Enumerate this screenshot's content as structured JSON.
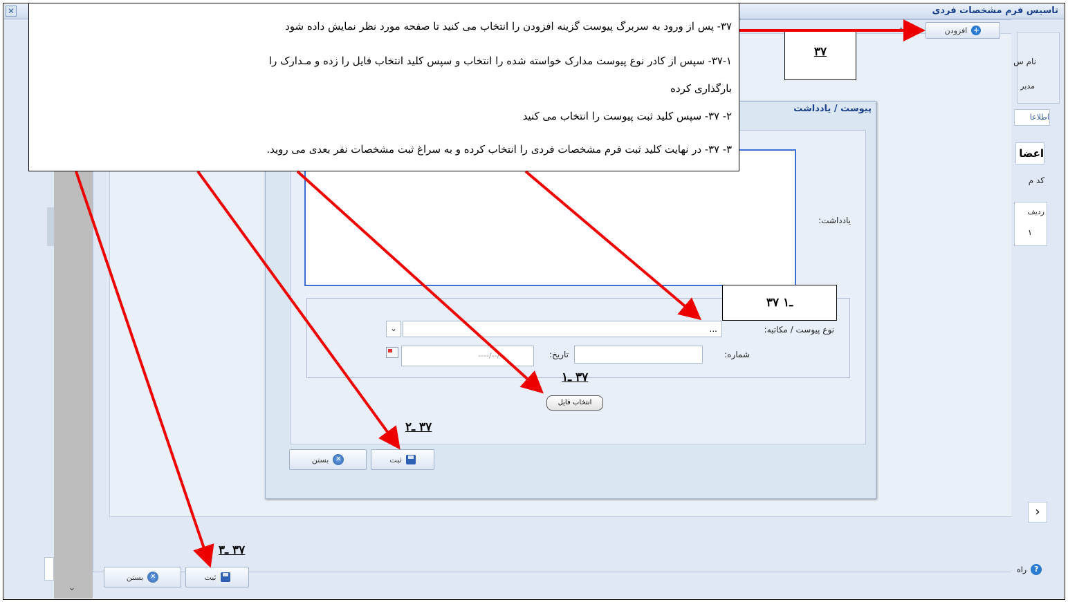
{
  "window": {
    "title": "تاسیس  فرم مشخصات فردی",
    "close_glyph": "✕"
  },
  "toolbar": {
    "add_label": "افزودن",
    "row_label": "ردیف"
  },
  "right_column": {
    "name_label": "نام س",
    "manager_label": "مدیر",
    "info_tab": "اطلاعا",
    "members_heading": "اعضا",
    "code_label": "کد م",
    "row_header": "ردیف",
    "row_value": "۱",
    "chevron": "›",
    "help_label": "راه"
  },
  "bottom_buttons": {
    "save_label": "ثبت",
    "close_label": "بستن"
  },
  "dialog": {
    "title": "پیوست / یادداشت",
    "note_label": "یادداشت:",
    "attachment_type_label": "نوع پیوست / مکاتبه:",
    "attachment_type_value": "...",
    "number_label": "شماره:",
    "date_label": "تاریخ:",
    "date_placeholder": "----/--/--",
    "choose_file_label": "انتخاب فایل",
    "save_label": "ثبت",
    "close_label": "بستن"
  },
  "instructions": [
    "۳۷- پس از ورود به سربرگ پیوست گزینه افزودن را انتخاب می کنید تا صفحه مورد نظر نمایش داده شود",
    "۳۷-۱- سپس از کادر نوع پیوست مدارک خواسته شده را انتخاب و سپس کلید انتخاب فایل را زده و مـدارک را",
    "بارگذاری کرده",
    "۲- ۳۷- سپس کلید ثبت پیوست را انتخاب می کنید",
    "۳- ۳۷- در نهایت کلید ثبت فرم مشخصات فردی را انتخاب کرده و به سراغ ثبت مشخصات نفر بعدی می روید."
  ],
  "callouts": {
    "step37": "۳۷",
    "step37_1_box": "۳۷ ـ۱",
    "step37_1": "۳۷ ـ۱",
    "step37_2": "۳۷ ـ۲",
    "step37_3": "۳۷ ـ۳"
  },
  "colors": {
    "arrow": "#ee0000",
    "title_blue": "#1a3f8a",
    "focus_border": "#3a6fd3"
  }
}
